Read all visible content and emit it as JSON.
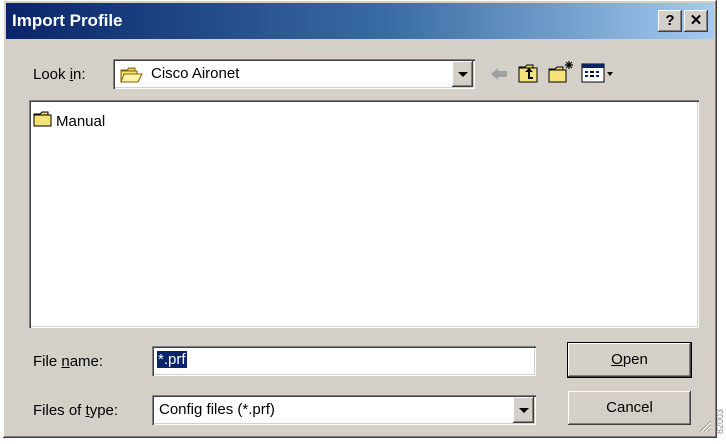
{
  "window": {
    "title": "Import Profile",
    "help_button": "?",
    "close_button": "✕"
  },
  "look_in": {
    "label_prefix": "Look ",
    "label_accel": "i",
    "label_suffix": "n:",
    "value": "Cisco Aironet"
  },
  "toolbar": {
    "back_icon": "back-arrow-icon",
    "up_icon": "up-folder-icon",
    "new_folder_icon": "new-folder-icon",
    "view_menu_icon": "view-menu-icon"
  },
  "files": [
    {
      "name": "Manual",
      "icon": "folder-icon"
    }
  ],
  "file_name": {
    "label_prefix": "File ",
    "label_accel": "n",
    "label_suffix": "ame:",
    "value": "*.prf"
  },
  "file_type": {
    "label_prefix": "Files of ",
    "label_accel": "t",
    "label_suffix": "ype:",
    "value": "Config files (*.prf)"
  },
  "buttons": {
    "open_accel": "O",
    "open_rest": "pen",
    "cancel": "Cancel"
  },
  "side_number": "82003"
}
